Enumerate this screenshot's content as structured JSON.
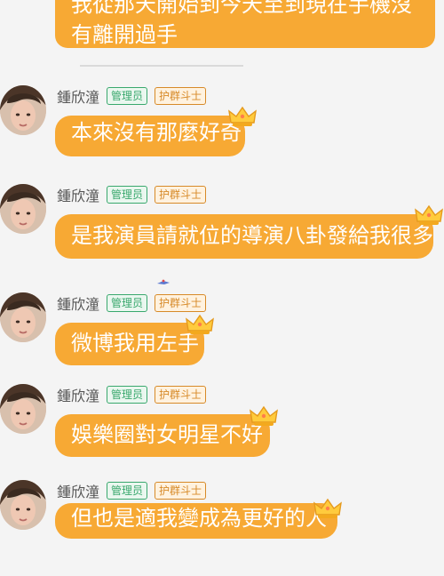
{
  "top_message": {
    "line1": "我從那天開始到今天至到現在手機沒",
    "line2": "有離開過手"
  },
  "messages": [
    {
      "sender": "鍾欣潼",
      "badge_admin": "管理员",
      "badge_rank": "护群斗士",
      "text": "本來沒有那麼好奇"
    },
    {
      "sender": "鍾欣潼",
      "badge_admin": "管理员",
      "badge_rank": "护群斗士",
      "text": "是我演員請就位的導演八卦發給我很多"
    },
    {
      "sender": "鍾欣潼",
      "badge_admin": "管理员",
      "badge_rank": "护群斗士",
      "text": "微博我用左手"
    },
    {
      "sender": "鍾欣潼",
      "badge_admin": "管理员",
      "badge_rank": "护群斗士",
      "text": "娛樂圈對女明星不好"
    },
    {
      "sender": "鍾欣潼",
      "badge_admin": "管理员",
      "badge_rank": "护群斗士",
      "text": "但也是適我變成為更好的人"
    }
  ],
  "colors": {
    "bubble": "#f7a934",
    "bubble_text": "#ffffff",
    "admin_badge": "#39a86d",
    "rank_badge": "#d78a28",
    "background": "#f4f4f4"
  },
  "icons": {
    "crown": "crown-icon",
    "avatar": "avatar"
  }
}
